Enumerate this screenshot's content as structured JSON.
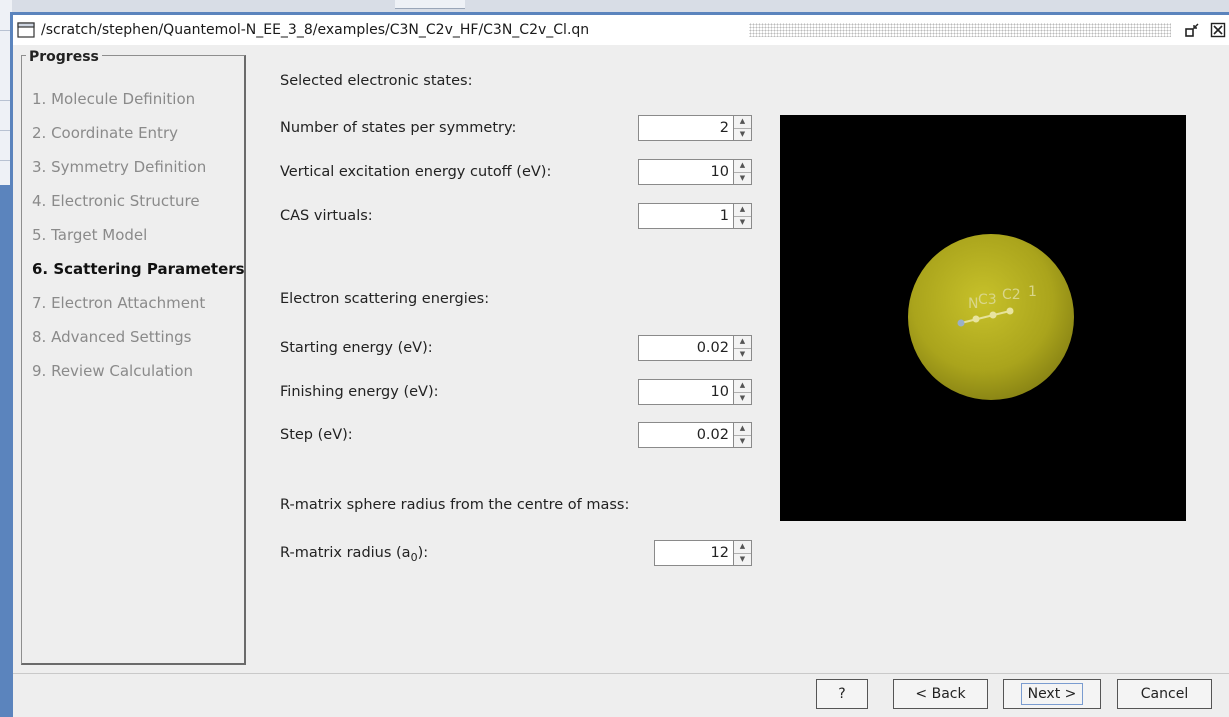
{
  "window": {
    "title": "/scratch/stephen/Quantemol-N_EE_3_8/examples/C3N_C2v_HF/C3N_C2v_Cl.qn"
  },
  "progress": {
    "legend": "Progress",
    "steps": [
      {
        "label": "1. Molecule Definition",
        "active": false
      },
      {
        "label": "2. Coordinate Entry",
        "active": false
      },
      {
        "label": "3. Symmetry Definition",
        "active": false
      },
      {
        "label": "4. Electronic Structure",
        "active": false
      },
      {
        "label": "5. Target Model",
        "active": false
      },
      {
        "label": "6. Scattering Parameters",
        "active": true
      },
      {
        "label": "7. Electron Attachment",
        "active": false
      },
      {
        "label": "8. Advanced Settings",
        "active": false
      },
      {
        "label": "9. Review Calculation",
        "active": false
      }
    ]
  },
  "form": {
    "electronic_states_heading": "Selected electronic states:",
    "states_per_symmetry": {
      "label": "Number of states per symmetry:",
      "value": "2"
    },
    "excitation_cutoff": {
      "label": "Vertical excitation energy cutoff (eV):",
      "value": "10"
    },
    "cas_virtuals": {
      "label": "CAS virtuals:",
      "value": "1"
    },
    "scattering_heading": "Electron scattering energies:",
    "starting_energy": {
      "label": "Starting energy (eV):",
      "value": "0.02"
    },
    "finishing_energy": {
      "label": "Finishing energy (eV):",
      "value": "10"
    },
    "step": {
      "label": "Step (eV):",
      "value": "0.02"
    },
    "rmatrix_heading": "R-matrix sphere radius from the centre of mass:",
    "rmatrix_radius": {
      "label_prefix": "R-matrix radius (a",
      "label_sub": "0",
      "label_suffix": "):",
      "value": "12"
    }
  },
  "viewer": {
    "atom_labels": [
      "N",
      "C3",
      "C2",
      "1"
    ],
    "sphere_color": "#b5b020",
    "background_color": "#000000"
  },
  "buttons": {
    "help": "?",
    "back": "< Back",
    "next": "Next >",
    "cancel": "Cancel"
  }
}
